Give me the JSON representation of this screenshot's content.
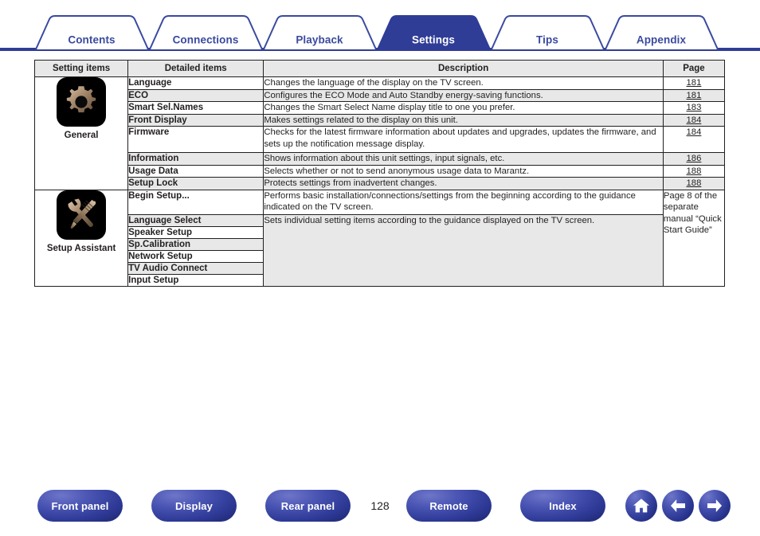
{
  "tabs": [
    {
      "label": "Contents",
      "active": false
    },
    {
      "label": "Connections",
      "active": false
    },
    {
      "label": "Playback",
      "active": false
    },
    {
      "label": "Settings",
      "active": true
    },
    {
      "label": "Tips",
      "active": false
    },
    {
      "label": "Appendix",
      "active": false
    }
  ],
  "table": {
    "headers": {
      "setting_items": "Setting items",
      "detailed_items": "Detailed items",
      "description": "Description",
      "page": "Page"
    },
    "groups": [
      {
        "icon_name": "gear-icon",
        "caption": "General",
        "rows": [
          {
            "detail": "Language",
            "desc": "Changes the language of the display on the TV screen.",
            "page": "181",
            "page_link": true
          },
          {
            "detail": "ECO",
            "desc": "Configures the ECO Mode and Auto Standby energy-saving functions.",
            "page": "181",
            "page_link": true
          },
          {
            "detail": "Smart Sel.Names",
            "desc": "Changes the Smart Select Name display title to one you prefer.",
            "page": "183",
            "page_link": true
          },
          {
            "detail": "Front Display",
            "desc": "Makes settings related to the display on this unit.",
            "page": "184",
            "page_link": true
          },
          {
            "detail": "Firmware",
            "desc": "Checks for the latest firmware information about updates and upgrades, updates the firmware, and sets up the notification message display.",
            "page": "184",
            "page_link": true
          },
          {
            "detail": "Information",
            "desc": "Shows information about this unit settings, input signals, etc.",
            "page": "186",
            "page_link": true
          },
          {
            "detail": "Usage Data",
            "desc": "Selects whether or not to send anonymous usage data to Marantz.",
            "page": "188",
            "page_link": true
          },
          {
            "detail": "Setup Lock",
            "desc": "Protects settings from inadvertent changes.",
            "page": "188",
            "page_link": true
          }
        ]
      },
      {
        "icon_name": "tools-icon",
        "caption": "Setup Assistant",
        "rows": [
          {
            "detail": "Begin Setup...",
            "desc": "Performs basic installation/connections/settings from the beginning according to the guidance indicated on the TV screen.",
            "page": "",
            "page_link": false
          },
          {
            "detail": "Language Select",
            "desc": "Sets individual setting items according to the guidance displayed on the TV screen.",
            "page": "",
            "page_link": false
          },
          {
            "detail": "Speaker Setup",
            "desc": "",
            "page": "",
            "page_link": false
          },
          {
            "detail": "Sp.Calibration",
            "desc": "",
            "page": "",
            "page_link": false
          },
          {
            "detail": "Network Setup",
            "desc": "",
            "page": "",
            "page_link": false
          },
          {
            "detail": "TV Audio Connect",
            "desc": "",
            "page": "",
            "page_link": false
          },
          {
            "detail": "Input Setup",
            "desc": "",
            "page": "",
            "page_link": false
          }
        ],
        "page_note": "Page 8 of the separate manual “Quick Start Guide”"
      }
    ]
  },
  "footer": {
    "page_number": "128",
    "buttons": [
      {
        "label": "Front panel",
        "name": "front-panel-button"
      },
      {
        "label": "Display",
        "name": "display-button"
      },
      {
        "label": "Rear panel",
        "name": "rear-panel-button"
      },
      {
        "label": "Remote",
        "name": "remote-button"
      },
      {
        "label": "Index",
        "name": "index-button"
      }
    ],
    "icon_buttons": [
      {
        "name": "home-icon"
      },
      {
        "name": "arrow-left-icon"
      },
      {
        "name": "arrow-right-icon"
      }
    ]
  },
  "colors": {
    "tab_blue": "#3a4a9f",
    "tab_active_fill": "#2f3d96",
    "header_gray": "#e8e8e8",
    "row_shaded": "#e8e8e8",
    "icon_bronze": "#a98c6b",
    "button_blue": "#2e3a96"
  }
}
